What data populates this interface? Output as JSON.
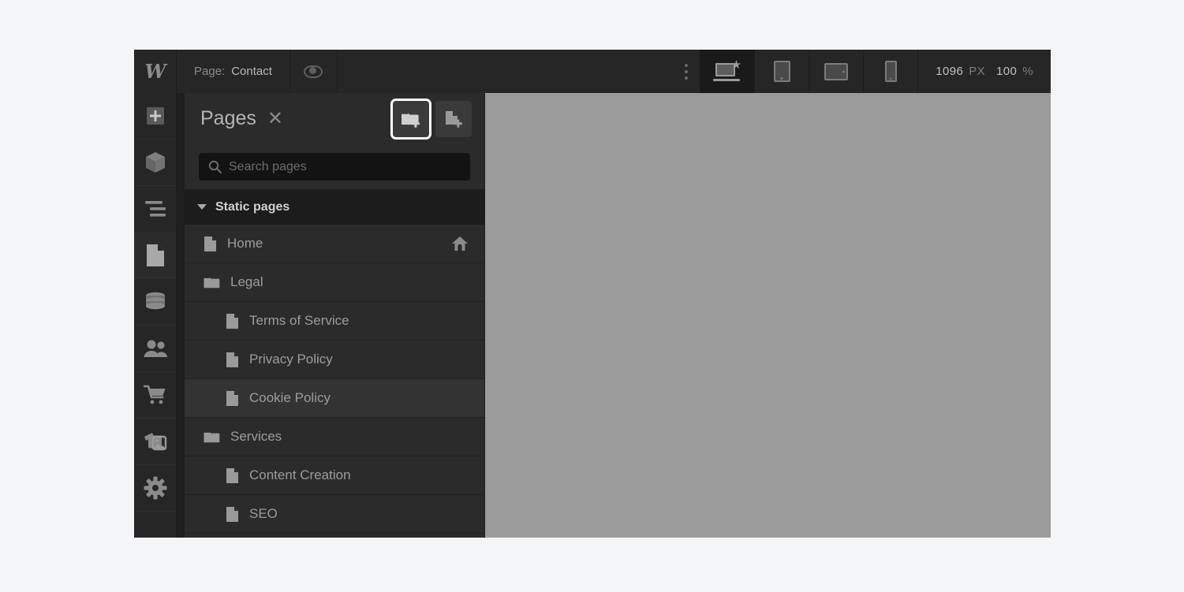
{
  "topbar": {
    "logo": "W",
    "page_label": "Page:",
    "page_name": "Contact",
    "preview_icon": "eye-icon",
    "overflow_icon": "kebab-menu-icon",
    "breakpoints": [
      {
        "name": "desktop",
        "icon": "desktop-starred-icon",
        "active": true
      },
      {
        "name": "tablet",
        "icon": "tablet-icon",
        "active": false
      },
      {
        "name": "tablet-landscape",
        "icon": "tablet-landscape-icon",
        "active": false
      },
      {
        "name": "mobile",
        "icon": "mobile-icon",
        "active": false
      }
    ],
    "canvas_width": "1096",
    "canvas_width_unit": "PX",
    "zoom_value": "100",
    "zoom_unit": "%"
  },
  "rail": {
    "items": [
      {
        "name": "add-elements",
        "icon": "plus-square-icon",
        "active": false
      },
      {
        "name": "components",
        "icon": "cube-icon",
        "active": false
      },
      {
        "name": "navigator",
        "icon": "layers-icon",
        "active": false
      },
      {
        "name": "pages",
        "icon": "page-icon",
        "active": true
      },
      {
        "name": "cms",
        "icon": "database-icon",
        "active": false
      },
      {
        "name": "users",
        "icon": "people-icon",
        "active": false
      },
      {
        "name": "ecommerce",
        "icon": "cart-icon",
        "active": false
      },
      {
        "name": "assets",
        "icon": "images-icon",
        "active": false
      },
      {
        "name": "settings",
        "icon": "gear-icon",
        "active": false
      }
    ]
  },
  "panel": {
    "title": "Pages",
    "close_label": "✕",
    "actions": [
      {
        "name": "add-folder",
        "icon": "folder-plus-icon",
        "focused": true
      },
      {
        "name": "add-page",
        "icon": "page-plus-icon",
        "focused": false
      }
    ],
    "search": {
      "placeholder": "Search pages",
      "value": "",
      "icon": "search-icon"
    },
    "section": {
      "title": "Static pages",
      "expanded": true,
      "caret_icon": "caret-down-icon"
    },
    "pages": [
      {
        "label": "Home",
        "icon": "page-icon",
        "depth": 0,
        "badge": "home-icon",
        "hovered": false
      },
      {
        "label": "Legal",
        "icon": "folder-icon",
        "depth": 0,
        "badge": "",
        "hovered": false
      },
      {
        "label": "Terms of Service",
        "icon": "page-icon",
        "depth": 1,
        "badge": "",
        "hovered": false
      },
      {
        "label": "Privacy Policy",
        "icon": "page-icon",
        "depth": 1,
        "badge": "",
        "hovered": false
      },
      {
        "label": "Cookie Policy",
        "icon": "page-icon",
        "depth": 1,
        "badge": "",
        "hovered": true
      },
      {
        "label": "Services",
        "icon": "folder-icon",
        "depth": 0,
        "badge": "",
        "hovered": false
      },
      {
        "label": "Content Creation",
        "icon": "page-icon",
        "depth": 1,
        "badge": "",
        "hovered": false
      },
      {
        "label": "SEO",
        "icon": "page-icon",
        "depth": 1,
        "badge": "",
        "hovered": false
      }
    ]
  },
  "colors": {
    "window_bg": "#262626",
    "panel_bg": "#2b2b2b",
    "section_bg": "#1c1c1c",
    "canvas_bg": "#9b9b9b",
    "page_bg": "#f4f5f7",
    "focus_ring": "#ffffff",
    "text_primary": "#b4b4b4",
    "text_secondary": "#9c9c9c"
  }
}
